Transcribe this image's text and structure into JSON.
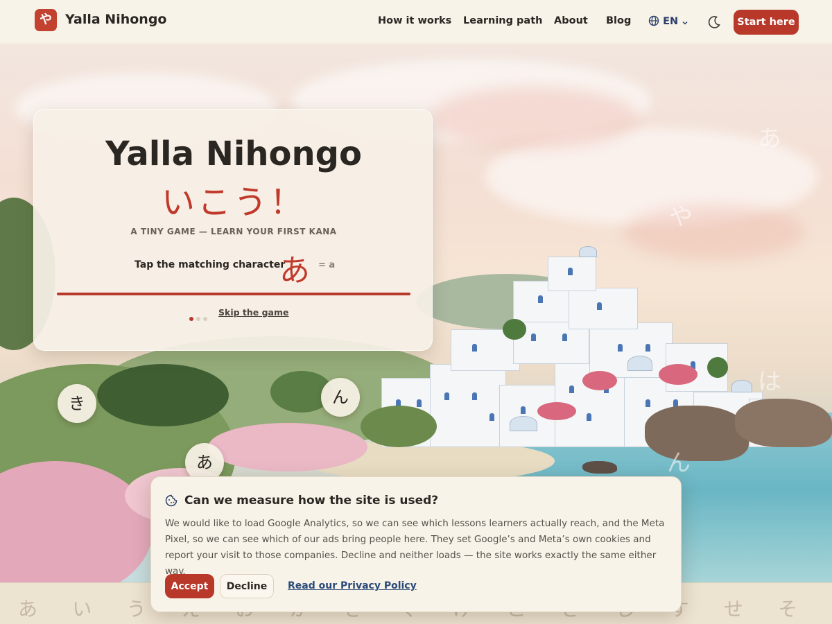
{
  "header": {
    "logo_glyph": "や",
    "brand": "Yalla Nihongo",
    "nav": [
      "How it works",
      "Learning path",
      "About",
      "Blog"
    ],
    "language": "EN",
    "start_button": "Start here"
  },
  "game": {
    "title": "Yalla Nihongo",
    "jp_title": "いこう！",
    "subtitle": "A TINY GAME — LEARN YOUR FIRST KANA",
    "prompt": "Tap the matching character",
    "kana": "あ",
    "romaji": "= a",
    "progress": 1.0,
    "step_count": 3,
    "current_step": 1,
    "skip_label": "Skip the game"
  },
  "bubbles": [
    "き",
    "ん",
    "あ"
  ],
  "scenery_kana": [
    "あ",
    "や",
    "は",
    "ん"
  ],
  "strip_kana": [
    "あ",
    "い",
    "う",
    "え",
    "お",
    "か",
    "き",
    "く",
    "け",
    "こ",
    "さ",
    "し",
    "す",
    "せ",
    "そ"
  ],
  "cookie": {
    "title": "Can we measure how the site is used?",
    "text": "We would like to load Google Analytics, so we can see which lessons learners actually reach, and the Meta Pixel, so we can see which of our ads bring people here. They set Google’s and Meta’s own cookies and report your visit to those companies. Decline and neither loads — the site works exactly the same either way.",
    "accept": "Accept",
    "decline": "Decline",
    "privacy_link": "Read our Privacy Policy"
  },
  "colors": {
    "accent": "#b8382a",
    "kana_red": "#c0392b",
    "background": "#f7f1e6",
    "link": "#2a4a7a"
  }
}
